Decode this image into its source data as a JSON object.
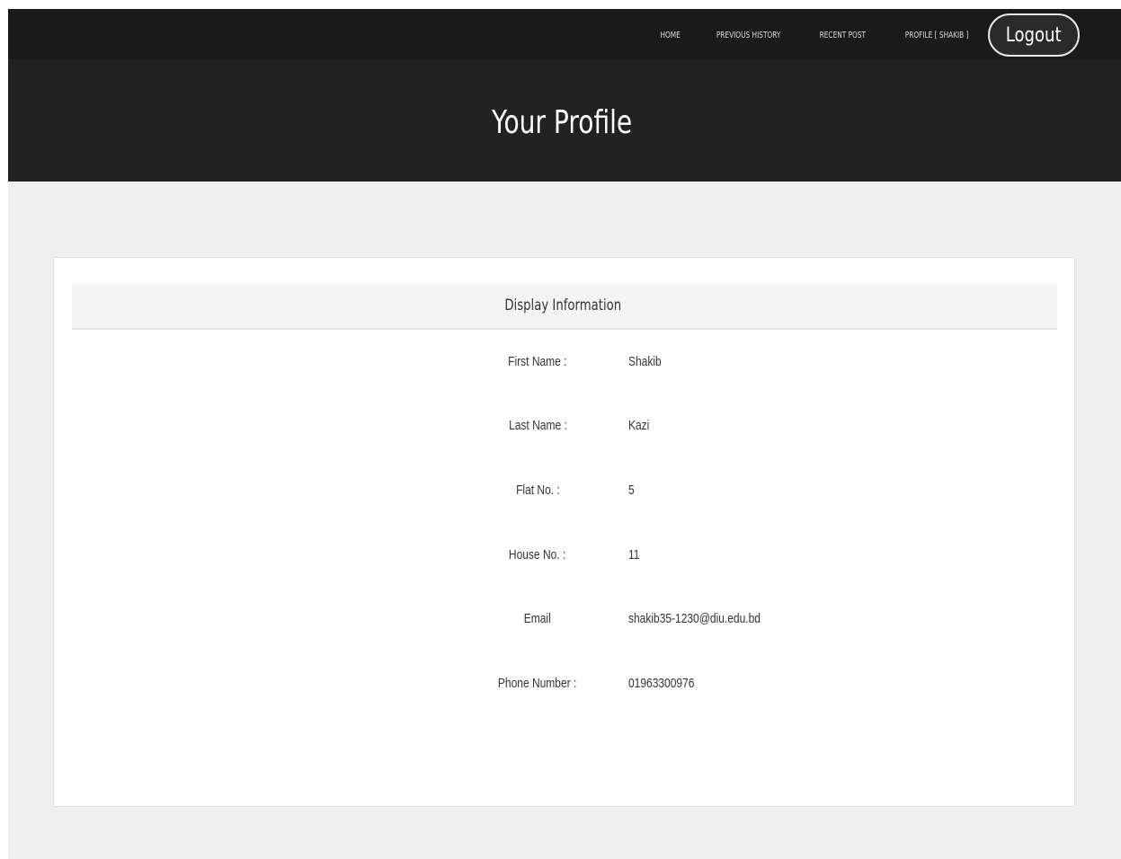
{
  "nav": {
    "items": [
      {
        "label": "HOME"
      },
      {
        "label": "PREVIOUS HISTORY"
      },
      {
        "label": "RECENT POST"
      },
      {
        "label": "PROFILE [ SHAKIB ]"
      }
    ],
    "logout_label": "Logout"
  },
  "hero": {
    "title": "Your Profile"
  },
  "card": {
    "header_title": "Display Information",
    "rows": [
      {
        "label": "First Name :",
        "value": "Shakib"
      },
      {
        "label": "Last Name :",
        "value": "Kazi"
      },
      {
        "label": "Flat No. :",
        "value": "5"
      },
      {
        "label": "House No. :",
        "value": "11"
      },
      {
        "label": "Email",
        "value": "shakib35-1230@diu.edu.bd"
      },
      {
        "label": "Phone Number :",
        "value": "01963300976"
      }
    ]
  }
}
